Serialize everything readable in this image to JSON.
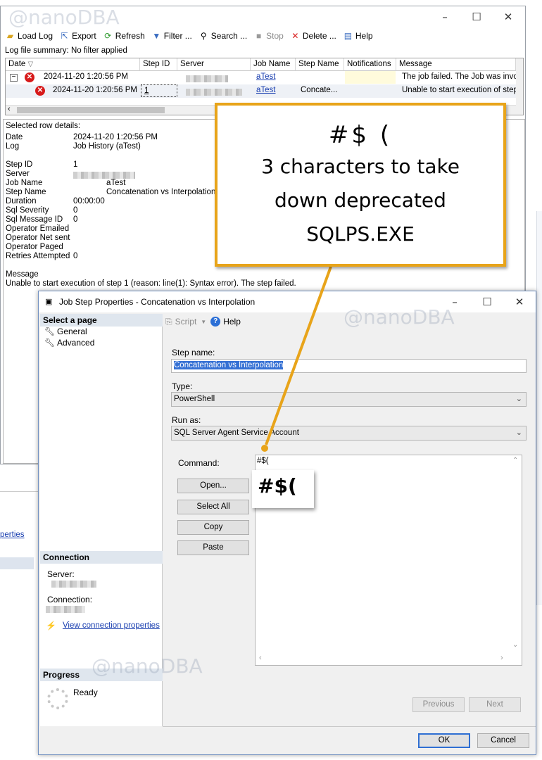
{
  "watermark": "@nanoDBA",
  "log_window": {
    "toolbar": [
      {
        "label": "Load Log",
        "icon": "folder-open-icon",
        "enabled": true
      },
      {
        "label": "Export",
        "icon": "export-icon",
        "enabled": true
      },
      {
        "label": "Refresh",
        "icon": "refresh-icon",
        "enabled": true
      },
      {
        "label": "Filter ...",
        "icon": "filter-icon",
        "enabled": true
      },
      {
        "label": "Search ...",
        "icon": "search-icon",
        "enabled": true
      },
      {
        "label": "Stop",
        "icon": "stop-icon",
        "enabled": false
      },
      {
        "label": "Delete ...",
        "icon": "delete-icon",
        "enabled": true
      },
      {
        "label": "Help",
        "icon": "help-icon",
        "enabled": true
      }
    ],
    "summary": "Log file summary: No filter applied",
    "columns": [
      "Date",
      "Step ID",
      "Server",
      "Job Name",
      "Step Name",
      "Notifications",
      "Message"
    ],
    "rows": [
      {
        "date": "2024-11-20 1:20:56 PM",
        "step_id": "",
        "job_name": "aTest",
        "step_name": "",
        "message": "The job failed.  The Job was invol"
      },
      {
        "date": "2024-11-20 1:20:56 PM",
        "step_id": "1",
        "job_name": "aTest",
        "step_name": "Concate...",
        "message": "Unable to start execution of step"
      }
    ],
    "details": {
      "header": "Selected row details:",
      "date_label": "Date",
      "date_value": "2024-11-20 1:20:56 PM",
      "log_label": "Log",
      "log_value": "Job History (aTest)",
      "step_id_label": "Step ID",
      "step_id_value": "1",
      "server_label": "Server",
      "job_name_label": "Job Name",
      "job_name_value": "aTest",
      "step_name_label": "Step Name",
      "step_name_value": "Concatenation vs Interpolation",
      "duration_label": "Duration",
      "duration_value": "00:00:00",
      "severity_label": "Sql Severity",
      "severity_value": "0",
      "msgid_label": "Sql Message ID",
      "msgid_value": "0",
      "emailed_label": "Operator Emailed",
      "netsent_label": "Operator Net sent",
      "paged_label": "Operator Paged",
      "retries_label": "Retries Attempted",
      "retries_value": "0",
      "message_label": "Message",
      "message_value": "Unable to start execution of step 1 (reason: line(1): Syntax error).  The step failed."
    },
    "side_link": "perties"
  },
  "dialog": {
    "title": "Job Step Properties - Concatenation vs Interpolation",
    "select_page_header": "Select a page",
    "pages": [
      "General",
      "Advanced"
    ],
    "toolbar": {
      "script": "Script",
      "help": "Help"
    },
    "connection_header": "Connection",
    "server_label": "Server:",
    "connection_label": "Connection:",
    "view_connection_link": "View connection properties",
    "progress_header": "Progress",
    "progress_status": "Ready",
    "step_name_label": "Step name:",
    "step_name_value": "Concatenation vs Interpolation",
    "type_label": "Type:",
    "type_value": "PowerShell",
    "run_as_label": "Run as:",
    "run_as_value": "SQL Server Agent Service Account",
    "command_label": "Command:",
    "command_value": "#$(",
    "buttons": {
      "open": "Open...",
      "select_all": "Select All",
      "copy": "Copy",
      "paste": "Paste",
      "previous": "Previous",
      "next": "Next",
      "ok": "OK",
      "cancel": "Cancel"
    }
  },
  "callout": {
    "chars": "#$ (",
    "line1": "3 characters to take",
    "line2": "down deprecated",
    "line3": "SQLPS.EXE",
    "zoom_text": "#$(",
    "color": "#e8a41a"
  }
}
